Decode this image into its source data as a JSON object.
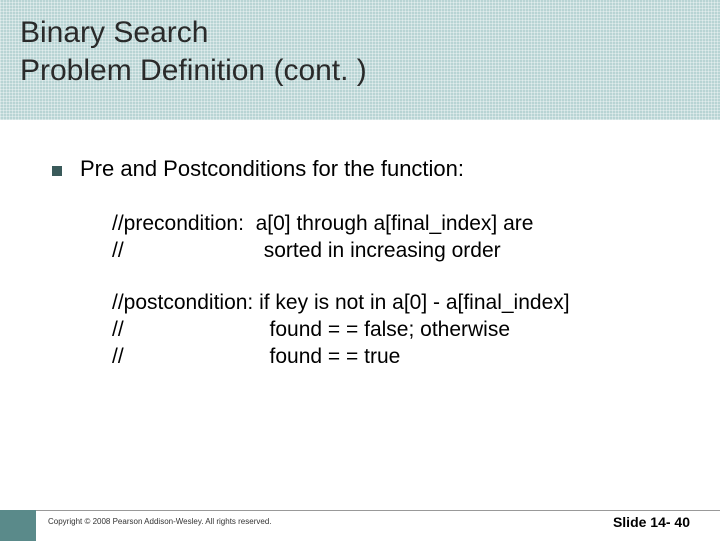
{
  "title_line1": "Binary Search",
  "title_line2": "Problem Definition (cont. )",
  "bullet": "Pre and Postconditions for the function:",
  "pre_line1": "//precondition:  a[0] through a[final_index] are",
  "pre_line2": "//                        sorted in increasing order",
  "post_line1": "//postcondition: if key is not in a[0] - a[final_index]",
  "post_line2": "//                         found = = false; otherwise",
  "post_line3": "//                         found = = true",
  "copyright": "Copyright © 2008 Pearson Addison-Wesley.  All rights reserved.",
  "slide_number": "Slide 14- 40"
}
